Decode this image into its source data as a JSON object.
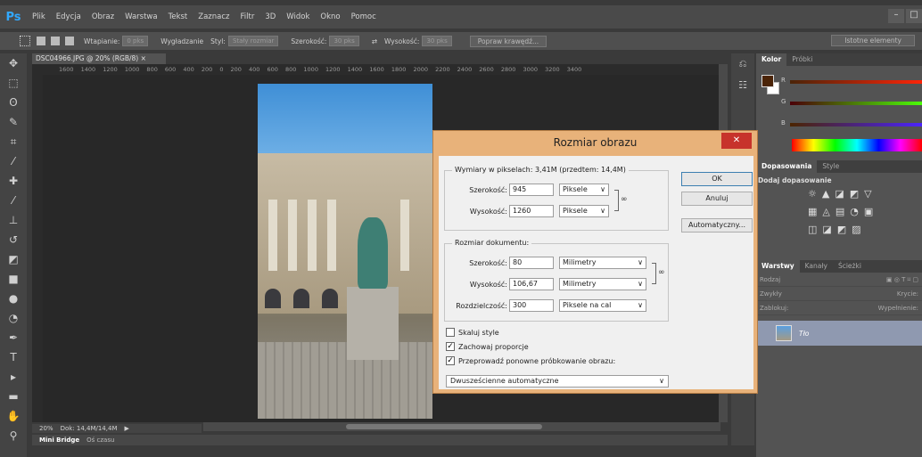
{
  "app": {
    "logo": "Ps",
    "menu": [
      "Plik",
      "Edycja",
      "Obraz",
      "Warstwa",
      "Tekst",
      "Zaznacz",
      "Filtr",
      "3D",
      "Widok",
      "Okno",
      "Pomoc"
    ],
    "window_controls": [
      "–",
      "□"
    ]
  },
  "options_bar": {
    "feather_label": "Wtapianie:",
    "feather_value": "0 pks",
    "antialias_label": "Wygładzanie",
    "style_label": "Styl:",
    "style_value": "Stały rozmiar",
    "width_label": "Szerokość:",
    "width_value": "30 pks",
    "height_label": "Wysokość:",
    "height_value": "30 pks",
    "refine_button": "Popraw krawędź...",
    "essentials_button": "Istotne elementy"
  },
  "document": {
    "tab_title": "DSC04966.JPG @ 20% (RGB/8)",
    "ruler_marks": "1600 1400 1200 1000 800 600 400 200 0 200 400 600 800 1000 1200 1400 1600 1800 2000 2200 2400 2600 2800 3000 3200 3400",
    "zoom": "20%",
    "doc_info": "Dok: 14,4M/14,4M"
  },
  "bottom_panel": {
    "mini_bridge": "Mini Bridge",
    "timeline": "Oś czasu"
  },
  "panels": {
    "color_tabs": [
      "Kolor",
      "Próbki"
    ],
    "color_labels": [
      "R",
      "G",
      "B"
    ],
    "adjustments_tabs": [
      "Dopasowania",
      "Style"
    ],
    "adjustments_title": "Dodaj dopasowanie",
    "layers_tabs": [
      "Warstwy",
      "Kanały",
      "Ścieżki"
    ],
    "layer_kind": "Rodzaj",
    "blend_mode": "Zwykły",
    "opacity_label": "Krycie:",
    "lock_label": "Zablokuj:",
    "fill_label": "Wypełnienie:",
    "layer_name": "Tło"
  },
  "dialog": {
    "title": "Rozmiar obrazu",
    "close": "✕",
    "pixel_dims_legend": "Wymiary w pikselach:",
    "pixel_dims_size": "3,41M (przedtem: 14,4M)",
    "px_width_label": "Szerokość:",
    "px_width_value": "945",
    "px_width_unit": "Piksele",
    "px_height_label": "Wysokość:",
    "px_height_value": "1260",
    "px_height_unit": "Piksele",
    "doc_size_legend": "Rozmiar dokumentu:",
    "doc_width_label": "Szerokość:",
    "doc_width_value": "80",
    "doc_width_unit": "Milimetry",
    "doc_height_label": "Wysokość:",
    "doc_height_value": "106,67",
    "doc_height_unit": "Milimetry",
    "resolution_label": "Rozdzielczość:",
    "resolution_value": "300",
    "resolution_unit": "Piksele na cal",
    "scale_styles": "Skaluj style",
    "constrain": "Zachowaj proporcje",
    "resample": "Przeprowadź ponowne próbkowanie obrazu:",
    "resample_method": "Dwusześcienne automatyczne",
    "ok": "OK",
    "cancel": "Anuluj",
    "auto": "Automatyczny..."
  },
  "colors": {
    "dialog_frame": "#e8b27a",
    "close_button": "#c7332b",
    "foreground": "#4b2408"
  }
}
